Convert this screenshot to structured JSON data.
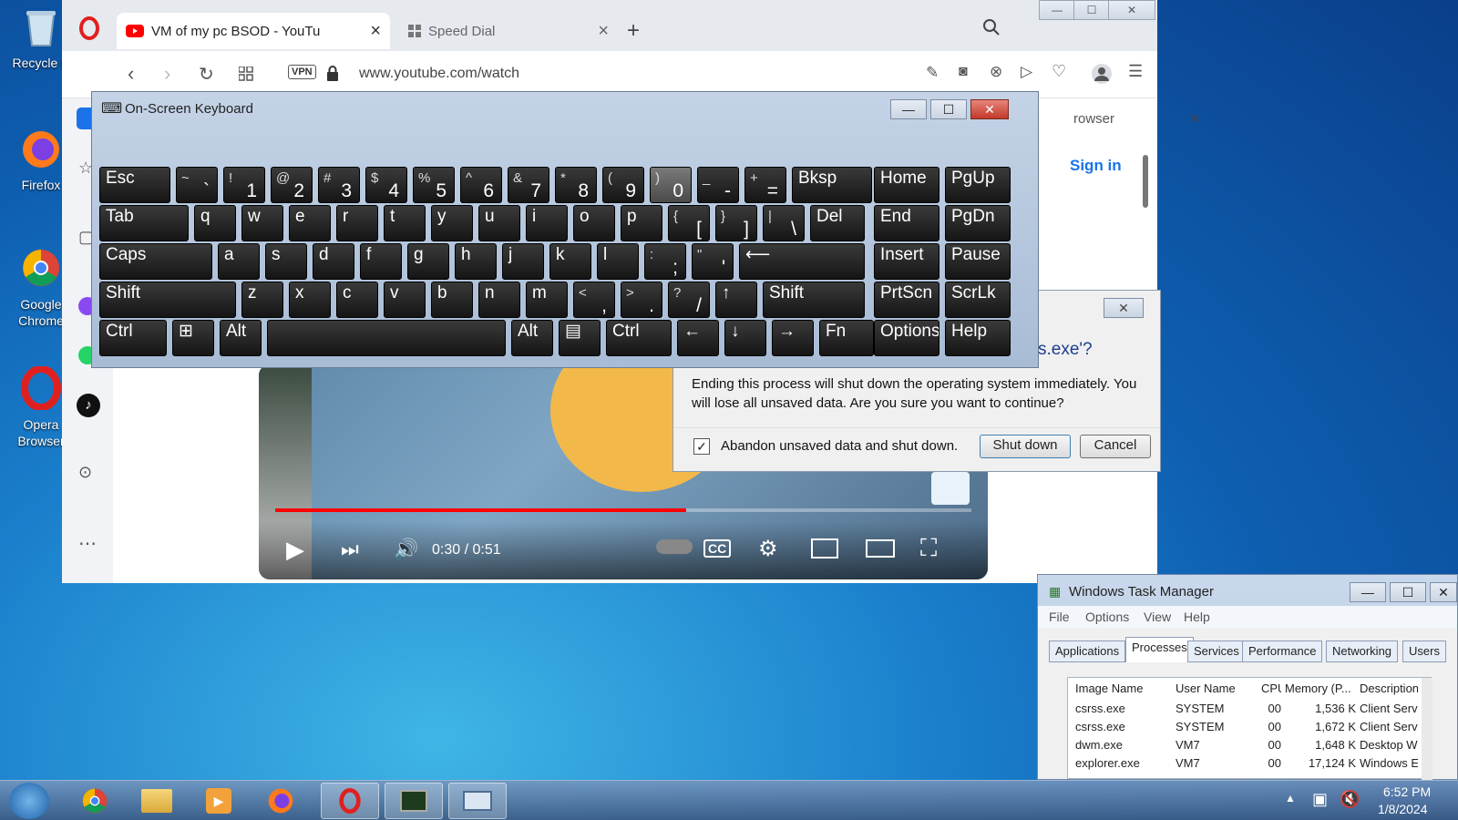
{
  "desktop": {
    "icons": [
      {
        "label": "Recycle B",
        "name": "recycle-bin-icon"
      },
      {
        "label": "Firefox",
        "name": "firefox-icon"
      },
      {
        "label": "Google\nChrome",
        "name": "chrome-icon"
      },
      {
        "label": "Opera\nBrowser",
        "name": "opera-icon"
      }
    ]
  },
  "browser": {
    "tabs": [
      {
        "label": "VM of my pc BSOD - YouTu",
        "icon": "youtube-icon"
      },
      {
        "label": "Speed Dial",
        "icon": "speed-dial-icon"
      }
    ],
    "vpn_badge": "VPN",
    "url": "www.youtube.com/watch",
    "partial_browser_text": "rowser",
    "sign_in": "Sign in"
  },
  "video": {
    "time": "0:30 / 0:51",
    "progress": 0.59
  },
  "osk": {
    "title": "On-Screen Keyboard",
    "rows": [
      [
        {
          "n": "Esc"
        },
        {
          "s": "~",
          "m": "`"
        },
        {
          "s": "!",
          "m": "1"
        },
        {
          "s": "@",
          "m": "2"
        },
        {
          "s": "#",
          "m": "3"
        },
        {
          "s": "$",
          "m": "4"
        },
        {
          "s": "%",
          "m": "5"
        },
        {
          "s": "^",
          "m": "6"
        },
        {
          "s": "&",
          "m": "7"
        },
        {
          "s": "*",
          "m": "8"
        },
        {
          "s": "(",
          "m": "9"
        },
        {
          "s": ")",
          "m": "0"
        },
        {
          "s": "_",
          "m": "-"
        },
        {
          "s": "+",
          "m": "="
        },
        {
          "n": "Bksp"
        },
        {
          "n": "Home"
        },
        {
          "n": "PgUp"
        }
      ],
      [
        {
          "n": "Tab"
        },
        {
          "n": "q"
        },
        {
          "n": "w"
        },
        {
          "n": "e"
        },
        {
          "n": "r"
        },
        {
          "n": "t"
        },
        {
          "n": "y"
        },
        {
          "n": "u"
        },
        {
          "n": "i"
        },
        {
          "n": "o"
        },
        {
          "n": "p"
        },
        {
          "s": "{",
          "m": "["
        },
        {
          "s": "}",
          "m": "]"
        },
        {
          "s": "|",
          "m": "\\"
        },
        {
          "n": "Del"
        },
        {
          "n": "End"
        },
        {
          "n": "PgDn"
        }
      ],
      [
        {
          "n": "Caps"
        },
        {
          "n": "a"
        },
        {
          "n": "s"
        },
        {
          "n": "d"
        },
        {
          "n": "f"
        },
        {
          "n": "g"
        },
        {
          "n": "h"
        },
        {
          "n": "j"
        },
        {
          "n": "k"
        },
        {
          "n": "l"
        },
        {
          "s": ":",
          "m": ";"
        },
        {
          "s": "\"",
          "m": "'"
        },
        {
          "n": "⟵"
        },
        {
          "n": "Insert"
        },
        {
          "n": "Pause"
        }
      ],
      [
        {
          "n": "Shift"
        },
        {
          "n": "z"
        },
        {
          "n": "x"
        },
        {
          "n": "c"
        },
        {
          "n": "v"
        },
        {
          "n": "b"
        },
        {
          "n": "n"
        },
        {
          "n": "m"
        },
        {
          "s": "<",
          "m": ","
        },
        {
          "s": ">",
          "m": "."
        },
        {
          "s": "?",
          "m": "/"
        },
        {
          "n": "↑"
        },
        {
          "n": "Shift"
        },
        {
          "n": "PrtScn"
        },
        {
          "n": "ScrLk"
        }
      ],
      [
        {
          "n": "Ctrl"
        },
        {
          "n": "⊞"
        },
        {
          "n": "Alt"
        },
        {
          "n": ""
        },
        {
          "n": "Alt"
        },
        {
          "n": "▤"
        },
        {
          "n": "Ctrl"
        },
        {
          "n": "←"
        },
        {
          "n": "↓"
        },
        {
          "n": "→"
        },
        {
          "n": "Fn"
        },
        {
          "n": "Options"
        },
        {
          "n": "Help"
        }
      ]
    ]
  },
  "dialog": {
    "question_fragment": "s.exe'?",
    "message": "Ending this process will shut down the operating system immediately.  You will lose all unsaved data.  Are you sure you want to continue?",
    "checkbox_label": "Abandon unsaved data and shut down.",
    "checkbox_checked": true,
    "shutdown_label": "Shut down",
    "cancel_label": "Cancel"
  },
  "task_manager": {
    "title": "Windows Task Manager",
    "menu": [
      "File",
      "Options",
      "View",
      "Help"
    ],
    "tabs": [
      "Applications",
      "Processes",
      "Services",
      "Performance",
      "Networking",
      "Users"
    ],
    "active_tab": "Processes",
    "columns": [
      "Image Name",
      "User Name",
      "CPU",
      "Memory (P...",
      "Description"
    ],
    "rows": [
      [
        "csrss.exe",
        "SYSTEM",
        "00",
        "1,536 K",
        "Client Serv"
      ],
      [
        "csrss.exe",
        "SYSTEM",
        "00",
        "1,672 K",
        "Client Serv"
      ],
      [
        "dwm.exe",
        "VM7",
        "00",
        "1,648 K",
        "Desktop W"
      ],
      [
        "explorer.exe",
        "VM7",
        "00",
        "17,124 K",
        "Windows E"
      ]
    ]
  },
  "taskbar": {
    "time": "6:52 PM",
    "date": "1/8/2024"
  },
  "colors": {
    "accent_red": "#e0201f",
    "youtube_red": "#ff0000",
    "link_blue": "#1a73e8"
  }
}
